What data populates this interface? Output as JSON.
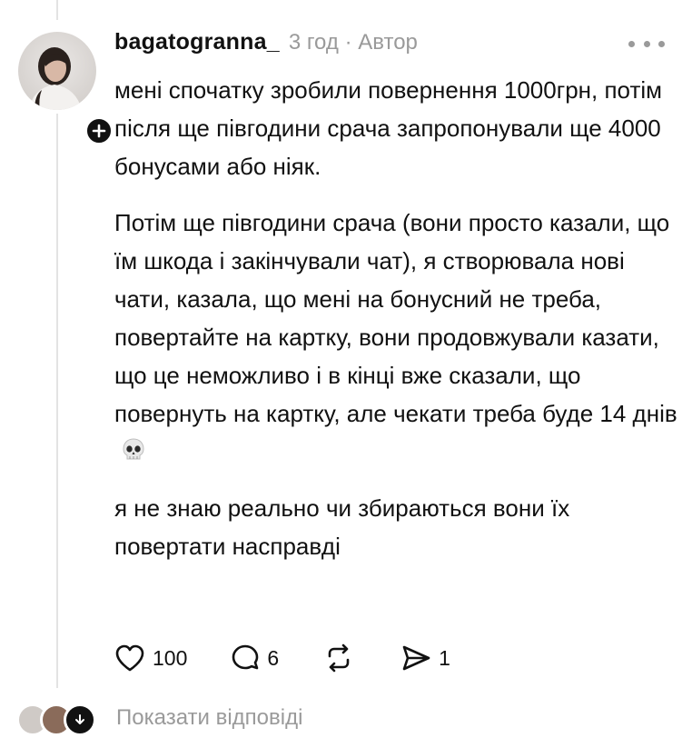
{
  "post": {
    "username": "bagatogranna_",
    "time": "3 год",
    "separator": "·",
    "role": "Автор",
    "paragraphs": [
      "мені спочатку зробили повернення 1000грн, потім після ще півгодини срача запропонували ще 4000 бонусами або ніяк.",
      "Потім ще півгодини срача (вони просто казали, що їм шкода і закінчували чат), я створювала нові чати, казала, що мені на бонусний не треба, повертайте на картку, вони продовжували казати, що це неможливо і в кінці вже сказали, що повернуть на картку, але чекати треба буде 14 днів",
      "я не знаю реально чи збираються вони їх повертати насправді"
    ],
    "emoji": "skull-icon"
  },
  "actions": {
    "likes": "100",
    "comments": "6",
    "shares": "1"
  },
  "replies": {
    "label": "Показати відповіді"
  },
  "colors": {
    "text": "#111111",
    "muted": "#9a9a9a",
    "thread_line": "#e3e3e3"
  }
}
